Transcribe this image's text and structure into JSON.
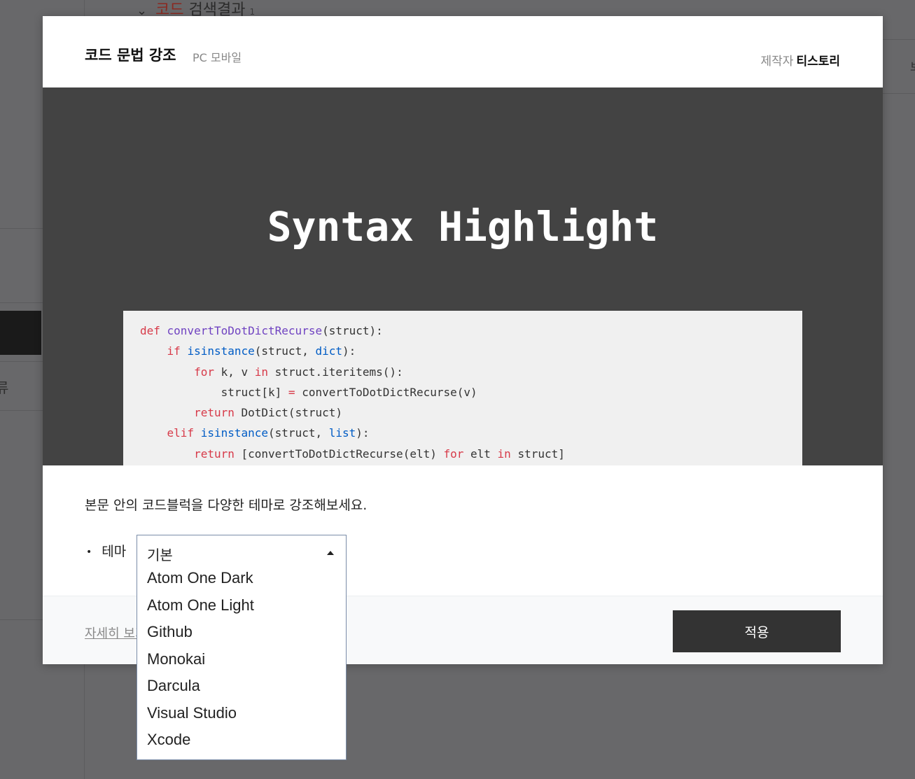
{
  "background": {
    "top_heading_red": "코드",
    "top_heading_rest": " 검색결과",
    "top_heading_count": "1",
    "left_char": "류",
    "right_char": "보"
  },
  "modal": {
    "title": "코드 문법 강조",
    "subtitle": "PC 모바일",
    "maker_label": "제작자",
    "maker_value": "티스토리",
    "preview_title": "Syntax Highlight",
    "code_lines": [
      [
        {
          "t": "def ",
          "c": "kw"
        },
        {
          "t": "convertToDotDictRecurse",
          "c": "fn"
        },
        {
          "t": "(struct):",
          "c": ""
        }
      ],
      [
        {
          "t": "    ",
          "c": ""
        },
        {
          "t": "if ",
          "c": "kw"
        },
        {
          "t": "isinstance",
          "c": "bi"
        },
        {
          "t": "(struct, ",
          "c": ""
        },
        {
          "t": "dict",
          "c": "bi"
        },
        {
          "t": "):",
          "c": ""
        }
      ],
      [
        {
          "t": "        ",
          "c": ""
        },
        {
          "t": "for ",
          "c": "kw"
        },
        {
          "t": "k, v ",
          "c": ""
        },
        {
          "t": "in ",
          "c": "kw"
        },
        {
          "t": "struct.iteritems():",
          "c": ""
        }
      ],
      [
        {
          "t": "            struct[k] ",
          "c": ""
        },
        {
          "t": "=",
          "c": "kw"
        },
        {
          "t": " convertToDotDictRecurse(v)",
          "c": ""
        }
      ],
      [
        {
          "t": "        ",
          "c": ""
        },
        {
          "t": "return ",
          "c": "kw"
        },
        {
          "t": "DotDict(struct)",
          "c": ""
        }
      ],
      [
        {
          "t": "    ",
          "c": ""
        },
        {
          "t": "elif ",
          "c": "kw"
        },
        {
          "t": "isinstance",
          "c": "bi"
        },
        {
          "t": "(struct, ",
          "c": ""
        },
        {
          "t": "list",
          "c": "bi"
        },
        {
          "t": "):",
          "c": ""
        }
      ],
      [
        {
          "t": "        ",
          "c": ""
        },
        {
          "t": "return ",
          "c": "kw"
        },
        {
          "t": "[convertToDotDictRecurse(elt) ",
          "c": ""
        },
        {
          "t": "for ",
          "c": "kw"
        },
        {
          "t": "elt ",
          "c": ""
        },
        {
          "t": "in ",
          "c": "kw"
        },
        {
          "t": "struct]",
          "c": ""
        }
      ]
    ],
    "description": "본문 안의 코드블럭을 다양한 테마로 강조해보세요.",
    "theme_label": "테마",
    "theme_select": {
      "selected": "기본",
      "options": [
        "Atom One Dark",
        "Atom One Light",
        "Github",
        "Monokai",
        "Darcula",
        "Visual Studio",
        "Xcode"
      ]
    },
    "more_link": "자세히 보기",
    "apply_label": "적용"
  },
  "colors": {
    "keyword": "#d73a49",
    "function": "#6f42c1",
    "builtin": "#005cc5",
    "preview_bg": "#434343",
    "apply_bg": "#333333"
  }
}
